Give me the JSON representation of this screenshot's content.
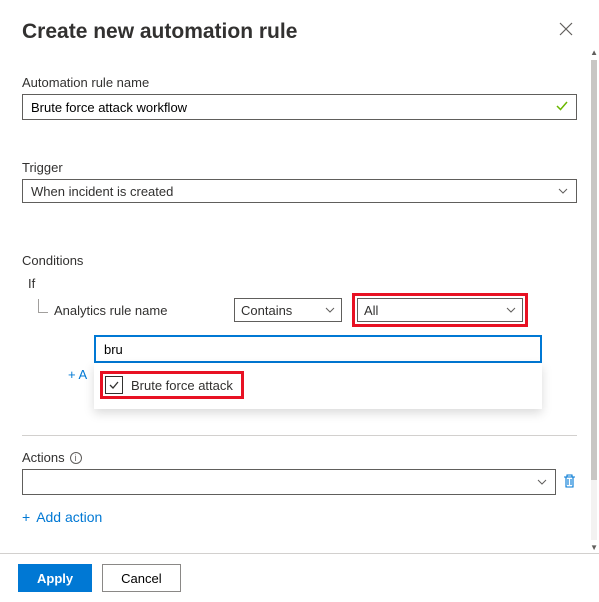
{
  "header": {
    "title": "Create new automation rule"
  },
  "rule_name": {
    "label": "Automation rule name",
    "value": "Brute force attack workflow"
  },
  "trigger": {
    "label": "Trigger",
    "value": "When incident is created"
  },
  "conditions": {
    "label": "Conditions",
    "if_label": "If",
    "field_label": "Analytics rule name",
    "operator": "Contains",
    "scope": "All",
    "search_value": "bru",
    "option_label": "Brute force attack",
    "add_partial": "+ A"
  },
  "actions": {
    "label": "Actions",
    "add_label": "Add action"
  },
  "footer": {
    "apply": "Apply",
    "cancel": "Cancel"
  }
}
